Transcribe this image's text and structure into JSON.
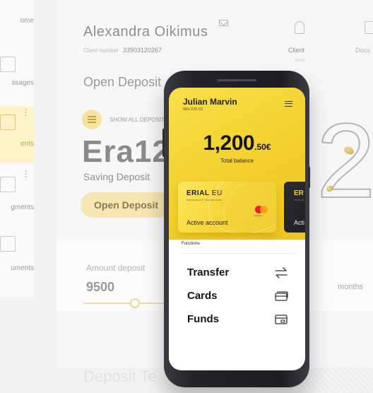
{
  "background": {
    "sidebar": [
      {
        "label": "ome"
      },
      {
        "label": "ssages"
      },
      {
        "label": "ents",
        "active": true
      },
      {
        "label": "gments"
      },
      {
        "label": "uments"
      }
    ],
    "header": {
      "name": "Alexandra Oikimus",
      "client_number_label": "Client number",
      "client_number": "33903120267",
      "nav_client": "Client",
      "nav_client_dots": "ooo",
      "nav_documents": "Docu"
    },
    "open_deposit_heading": "Open Deposit",
    "show_all_deposits": "SHOW ALL DEPOSITS",
    "deposit_title": "Era12",
    "deposit_subtitle": "Saving Deposit",
    "open_deposit_button": "Open Deposit",
    "big_numeral": "2",
    "amount_label": "Amount deposit",
    "amount_value": "9500",
    "months_label": "months",
    "deposit_terms": "Deposit Te"
  },
  "phone": {
    "user_name": "Julian Marvin",
    "user_number": "983-235-02",
    "balance_main": "1,200",
    "balance_cents": ".50€",
    "balance_label": "Total balance",
    "card_primary": {
      "brand_bold": "ERIAL",
      "brand_light": " EU",
      "tagline": "PERSONALITY YELLOW CARD",
      "network": "mastercard",
      "status": "Active account"
    },
    "card_secondary": {
      "brand": "ER",
      "tagline": "PERSONA",
      "status": "Acti"
    },
    "functions_label": "Functions",
    "functions": [
      {
        "label": "Transfer",
        "icon": "transfer-arrows-icon"
      },
      {
        "label": "Cards",
        "icon": "card-stack-icon"
      },
      {
        "label": "Funds",
        "icon": "funds-wallet-icon"
      }
    ]
  },
  "colors": {
    "accent_yellow": "#f3cf2a",
    "dark": "#1d1d21",
    "bg": "#f3f3f4"
  }
}
